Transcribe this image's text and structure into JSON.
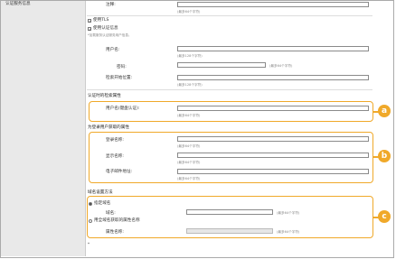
{
  "sidebar": {
    "section_label": "认证服务信息"
  },
  "form": {
    "comment": {
      "label": "注释:",
      "hint": "(最多64个字符)"
    },
    "tls": {
      "label": "使用TLS",
      "checked": true
    },
    "use_auth": {
      "label": "使用认证信息",
      "checked": true,
      "note": "*加载服务认证服务用户信息。"
    },
    "username": {
      "label": "用户名:",
      "hint": "(最多128个字符)"
    },
    "password": {
      "label": "密码:",
      "hint": "(最多64个字符)"
    },
    "search_start": {
      "label": "检索开始位置:",
      "hint": "(最多128个字符)"
    },
    "attr_section": {
      "title": "认证时的检索属性"
    },
    "user_attr": {
      "label": "用户名(键盘认证):",
      "hint": "(最多64个字符)"
    },
    "reg_section": {
      "title": "为登录用户获取的属性"
    },
    "login_name": {
      "label": "登录名称:",
      "hint": "(最多64个字符)"
    },
    "display_name": {
      "label": "显示名称:",
      "hint": "(最多64个字符)"
    },
    "email": {
      "label": "电子邮件地址:",
      "hint": "(最多64个字符)"
    },
    "domain_section": {
      "title": "域名设置方法"
    },
    "specify_domain": {
      "label": "指定域名",
      "selected": true
    },
    "domain_field": {
      "label": "域名:",
      "hint": "(最多64个字符)"
    },
    "attr_domain": {
      "label": "用全域名获取的属性名称",
      "selected": false
    },
    "attr_name": {
      "label": "属性名称:",
      "hint": "(最多64个字符)"
    }
  },
  "callouts": [
    "a",
    "b",
    "c"
  ],
  "colors": {
    "accent": "#f0a92a"
  }
}
